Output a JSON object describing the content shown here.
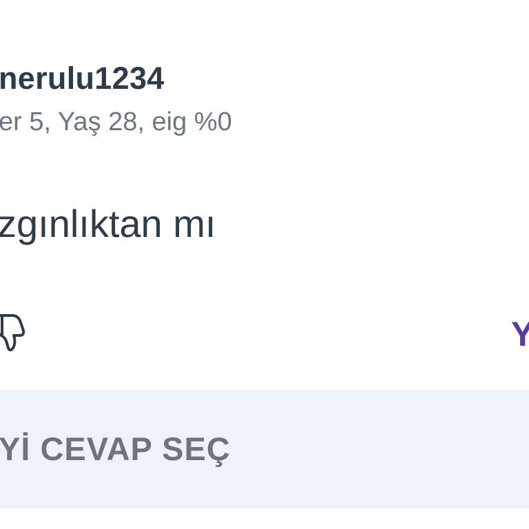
{
  "answer": {
    "username": "nerulu1234",
    "meta": "er 5, Yaş 28, eig %0",
    "text": "zgınlıktan mı"
  },
  "actions": {
    "dislike_icon": "thumbs-down-icon",
    "reply_label": "Y"
  },
  "best_answer": {
    "label": "Yİ CEVAP SEÇ",
    "background": "#edf2fb"
  },
  "colors": {
    "text_primary": "#2e3b48",
    "text_secondary": "#6c7680",
    "accent": "#5b3aa8"
  }
}
